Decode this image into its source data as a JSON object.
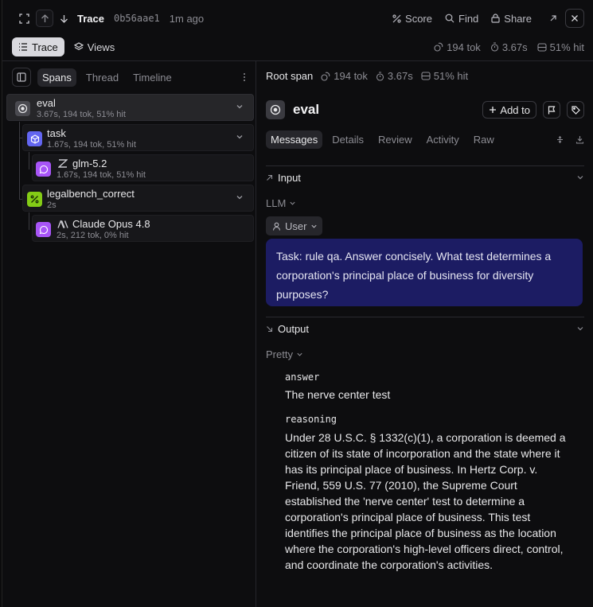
{
  "topbar": {
    "title": "Trace",
    "hash": "0b56aae1",
    "ago": "1m ago",
    "actions": {
      "score": "Score",
      "find": "Find",
      "share": "Share"
    }
  },
  "secondbar": {
    "trace_tab": "Trace",
    "views_tab": "Views",
    "tokens": "194 tok",
    "duration": "3.67s",
    "cache": "51% hit"
  },
  "left": {
    "tabs": [
      "Spans",
      "Thread",
      "Timeline"
    ],
    "nodes": [
      {
        "name": "eval",
        "meta": "3.67s, 194 tok, 51% hit"
      },
      {
        "name": "task",
        "meta": "1.67s, 194 tok, 51% hit"
      },
      {
        "name": "glm-5.2",
        "meta": "1.67s, 194 tok, 51% hit"
      },
      {
        "name": "legalbench_correct",
        "meta": "2s"
      },
      {
        "name": "Claude Opus 4.8",
        "meta": "2s, 212 tok, 0% hit"
      }
    ]
  },
  "right": {
    "root_label": "Root span",
    "tokens": "194 tok",
    "duration": "3.67s",
    "cache": "51% hit",
    "title": "eval",
    "add_to": "Add to",
    "tabs": [
      "Messages",
      "Details",
      "Review",
      "Activity",
      "Raw"
    ],
    "input": {
      "header": "Input",
      "format": "LLM",
      "role": "User",
      "message": "Task: rule qa. Answer concisely. What test determines a corporation's principal place of business for diversity purposes?"
    },
    "output": {
      "header": "Output",
      "format": "Pretty",
      "answer_key": "answer",
      "answer_val": "The nerve center test",
      "reasoning_key": "reasoning",
      "reasoning_val": "Under 28 U.S.C. § 1332(c)(1), a corporation is deemed a citizen of its state of incorporation and the state where it has its principal place of business. In Hertz Corp. v. Friend, 559 U.S. 77 (2010), the Supreme Court established the 'nerve center' test to determine a corporation's principal place of business. This test identifies the principal place of business as the location where the corporation's high-level officers direct, control, and coordinate the corporation's activities."
    }
  },
  "colors": {
    "message_bg": "#1c1c63",
    "eval_badge": "#4a4a50",
    "task_badge": "#6366f1",
    "llm_badge": "#a855f7",
    "scorer_badge": "#84cc16"
  },
  "icons": [
    "expand-icon",
    "arrow-up-icon",
    "arrow-down-icon",
    "score-icon",
    "search-icon",
    "lock-icon",
    "external-link-icon",
    "close-icon",
    "list-icon",
    "layers-icon",
    "coins-icon",
    "timer-icon",
    "database-icon",
    "panel-icon",
    "kebab-icon",
    "target-icon",
    "cube-icon",
    "message-icon",
    "percent-icon",
    "plus-icon",
    "flag-icon",
    "tag-icon",
    "chevron-down-icon",
    "user-icon"
  ]
}
